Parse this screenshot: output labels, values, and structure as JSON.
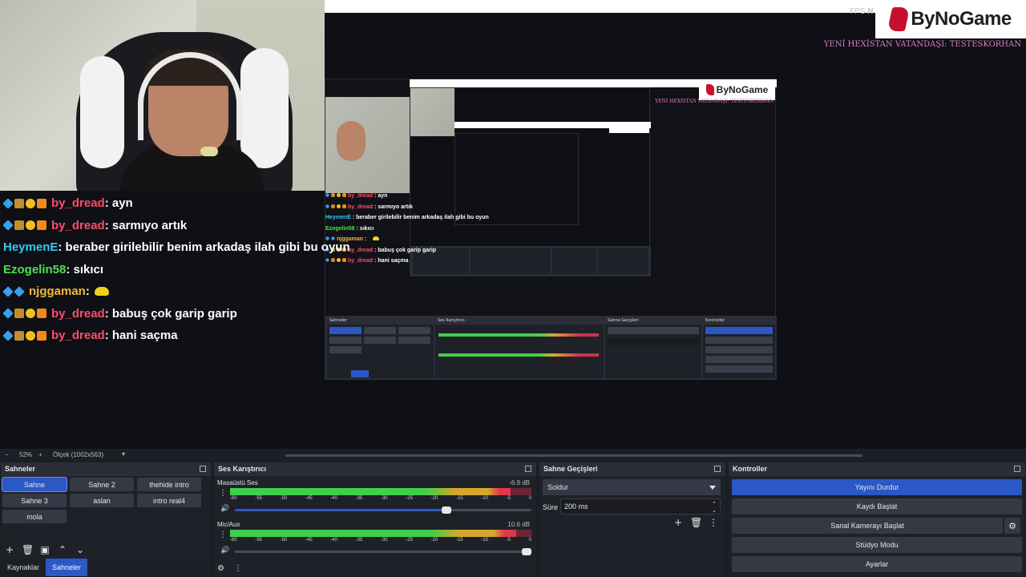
{
  "overlay": {
    "fps_label": "FPS",
    "fps_value": "N",
    "brand": "ByNoGame",
    "ticker": "YENİ HEXİSTAN VATANDAŞI: TESTESKORHAN"
  },
  "chat": [
    {
      "user": "by_dread",
      "sep": " : ",
      "text": "ayn",
      "color": "red",
      "badges": true
    },
    {
      "user": "by_dread",
      "sep": " : ",
      "text": "sarmıyo artık",
      "color": "red",
      "badges": true
    },
    {
      "user": "HeymenE",
      "sep": " : ",
      "text": "beraber girilebilir benim arkadaş ilah gibi bu oyun",
      "color": "cyan",
      "badges": false
    },
    {
      "user": "Ezogelin58",
      "sep": " : ",
      "text": "sıkıcı",
      "color": "green",
      "badges": false
    },
    {
      "user": "njggaman",
      "sep": " : ",
      "text": "",
      "color": "gold",
      "badges": "alt",
      "emote": true
    },
    {
      "user": "by_dread",
      "sep": " : ",
      "text": "babuş çok garip garip",
      "color": "red",
      "badges": true
    },
    {
      "user": "by_dread",
      "sep": " : ",
      "text": "hani saçma",
      "color": "red",
      "badges": true
    }
  ],
  "scalebar": {
    "minus": "−",
    "zoom": "52%",
    "plus": "+",
    "scale": "Ölçek (1002x563)"
  },
  "scenes": {
    "title": "Sahneler",
    "items": [
      "Sahne",
      "Sahne 2",
      "thehide intro",
      "Sahne 3",
      "aslan",
      "intro real4",
      "mola"
    ],
    "active": "Sahne",
    "tabs": [
      "Kaynaklar",
      "Sahneler"
    ],
    "active_tab": "Sahneler"
  },
  "mixer": {
    "title": "Ses Karıştırıcı",
    "channels": [
      {
        "name": "Masaüstü Ses",
        "db": "-6.9 dB",
        "level": 0.93,
        "volume": 0.73
      },
      {
        "name": "Mic/Aux",
        "db": "10.6 dB",
        "level": 0.95,
        "volume": 1.0
      }
    ],
    "scale": [
      "-60",
      "-55",
      "-50",
      "-45",
      "-40",
      "-35",
      "-30",
      "-25",
      "-20",
      "-15",
      "-10",
      "-5",
      "0"
    ]
  },
  "transitions": {
    "title": "Sahne Geçişleri",
    "selected": "Soldur",
    "duration_label": "Süre",
    "duration_value": "200 ms"
  },
  "controls": {
    "title": "Kontroller",
    "buttons": [
      "Yayını Durdur",
      "Kaydı Başlat",
      "Sanal Kamerayı Başlat",
      "Stüdyo Modu",
      "Ayarlar"
    ]
  },
  "nested": {
    "brand": "ByNoGame",
    "ticker": "YENİ HEXİSTAN VATANDAŞI: TESTESKORHAN"
  },
  "colors": {
    "accent": "#2a58c4",
    "panel": "#272a33",
    "chat_red": "#ff4c6a",
    "chat_cyan": "#39c8f0",
    "chat_green": "#4fe04f",
    "chat_gold": "#f3b93a",
    "brand_red": "#c8102e"
  }
}
